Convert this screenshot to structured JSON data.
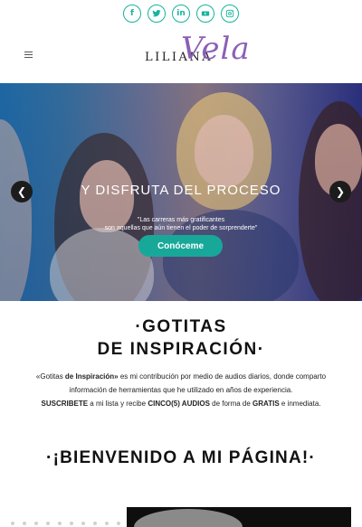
{
  "social": {
    "facebook": {
      "icon": "facebook-icon",
      "glyph": "f"
    },
    "twitter": {
      "icon": "twitter-icon"
    },
    "linkedin": {
      "icon": "linkedin-icon",
      "glyph": "in"
    },
    "youtube": {
      "icon": "youtube-icon"
    },
    "instagram": {
      "icon": "instagram-icon"
    }
  },
  "header": {
    "logo_first": "LILIANA",
    "logo_second": "Vela"
  },
  "hero": {
    "title": "Y DISFRUTA DEL PROCESO",
    "quote_line1": "\"Las carreras más gratificantes",
    "quote_line2": "son aquellas que aún tienen el poder de sorprenderte\"",
    "cta_label": "Conóceme",
    "prev_glyph": "❮",
    "next_glyph": "❯"
  },
  "gotitas": {
    "title": "·GOTITAS",
    "subtitle": "DE INSPIRACIÓN·",
    "desc_p1": "«Gotitas ",
    "desc_p1_bold": "de Inspiración»",
    "desc_p1_rest": " es mi contribución por medio de audios diarios, donde comparto información de herramientas que he utilizado en años de experiencia.",
    "desc_p2_bold1": "SUSCRIBETE",
    "desc_p2_text1": " a mi lista y recibe ",
    "desc_p2_bold2": "CINCO(5) AUDIOS",
    "desc_p2_text2": " de forma de ",
    "desc_p2_bold3": "GRATIS",
    "desc_p2_text3": " e inmediata."
  },
  "welcome": {
    "strong": "·¡BIENVENIDO",
    "rest": " A MI PÁGINA!·"
  },
  "colors": {
    "accent": "#16b39e",
    "brand_purple": "#8b5fb6"
  }
}
